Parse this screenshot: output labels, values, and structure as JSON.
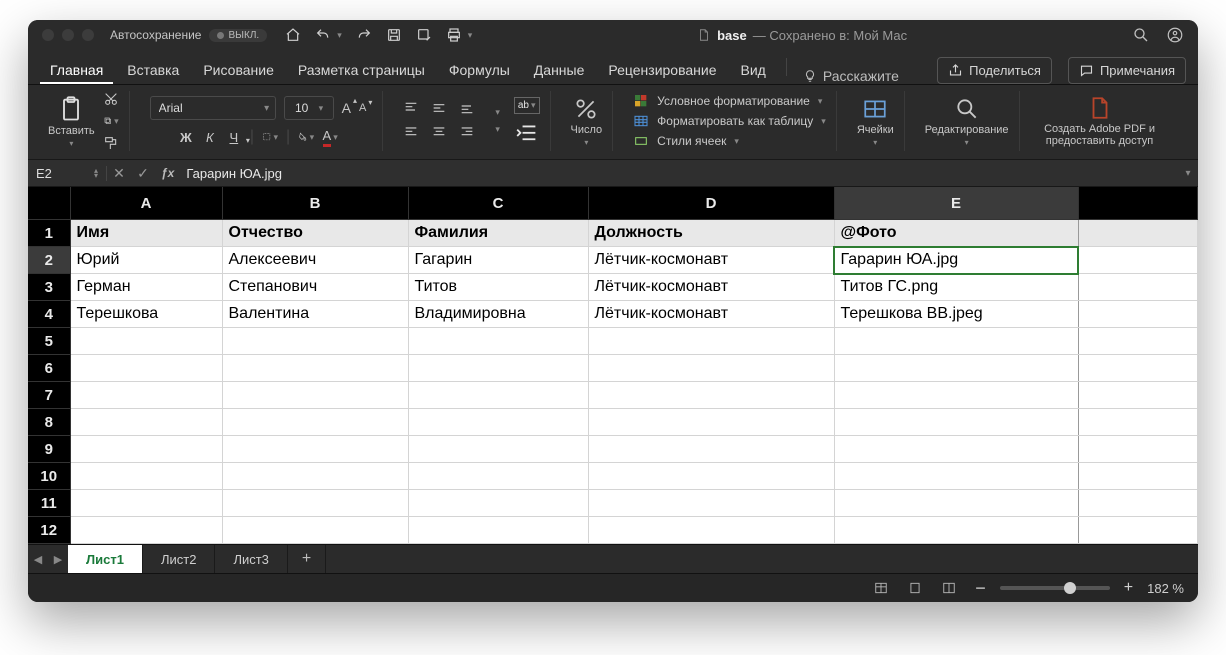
{
  "titlebar": {
    "autosave_label": "Автосохранение",
    "autosave_state": "ВЫКЛ.",
    "doc_name": "base",
    "doc_subtitle": "— Сохранено в: Мой Мас"
  },
  "tabs": {
    "items": [
      "Главная",
      "Вставка",
      "Рисование",
      "Разметка страницы",
      "Формулы",
      "Данные",
      "Рецензирование",
      "Вид"
    ],
    "active": 0,
    "tell_me": "Расскажите",
    "share": "Поделиться",
    "comments": "Примечания"
  },
  "ribbon": {
    "paste": "Вставить",
    "font_name": "Arial",
    "font_size": "10",
    "number": "Число",
    "cond_format": "Условное форматирование",
    "as_table": "Форматировать как таблицу",
    "cell_styles": "Стили ячеек",
    "cells": "Ячейки",
    "editing": "Редактирование",
    "adobe": "Создать Adobe PDF и предоставить доступ"
  },
  "formula_bar": {
    "name_box": "E2",
    "value": "Гарарин ЮА.jpg"
  },
  "grid": {
    "columns": [
      "A",
      "B",
      "C",
      "D",
      "E"
    ],
    "selected_col": "E",
    "selected_row": "2",
    "header_row": [
      "Имя",
      "Отчество",
      "Фамилия",
      "Должность",
      "@Фото"
    ],
    "rows": [
      [
        "Юрий",
        "Алексеевич",
        "Гагарин",
        "Лётчик-космонавт",
        "Гарарин ЮА.jpg"
      ],
      [
        "Герман",
        "Степанович",
        "Титов",
        "Лётчик-космонавт",
        "Титов ГС.png"
      ],
      [
        "Терешкова",
        "Валентина",
        "Владимировна",
        "Лётчик-космонавт",
        "Терешкова ВВ.jpeg"
      ]
    ],
    "visible_rows": 12
  },
  "sheets": {
    "items": [
      "Лист1",
      "Лист2",
      "Лист3"
    ],
    "active": 0
  },
  "status": {
    "zoom": "182 %"
  }
}
